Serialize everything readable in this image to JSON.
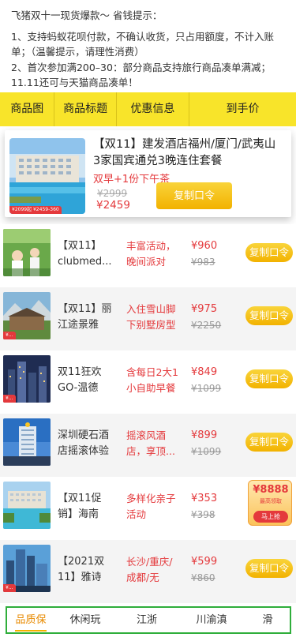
{
  "notice": {
    "title": "飞猪双十一现货爆款～ 省钱提示：",
    "line1": "1、支持蚂蚁花呗付款，不确认收货，只占用额度，不计入账单；（温馨提示，请理性消费）",
    "line2": "2、首次参加满200–30：部分商品支持旅行商品凑单满减；11.11还可与天猫商品凑单！"
  },
  "columns": {
    "image": "商品图",
    "title": "商品标题",
    "promo": "优惠信息",
    "price": "到手价"
  },
  "featured": {
    "title": "【双11】建发酒店福州/厦门/武夷山3家国宾通兑3晚连住套餐",
    "subtitle": "双早+1份下午茶",
    "original_price": "¥2999",
    "price": "¥2459",
    "button": "复制口令",
    "thumb_tag": "¥2099起 ¥2459-360"
  },
  "items": [
    {
      "name": "【双11】clubmed...",
      "promo": "丰富活动，晚间派对",
      "price": "¥960",
      "original": "¥983",
      "button": "复制口令"
    },
    {
      "name": "【双11】丽江途景雅阁...",
      "promo": "入住雪山脚下别墅房型",
      "price": "¥975",
      "original": "¥2250",
      "button": "复制口令"
    },
    {
      "name": "双11狂欢GO-温德姆...",
      "promo": "含每日2大1小自助早餐",
      "price": "¥849",
      "original": "¥1099",
      "button": "复制口令"
    },
    {
      "name": "深圳硬石酒店摇滚体验1...",
      "promo": "摇滚风酒店，享顶...",
      "price": "¥899",
      "original": "¥1099",
      "button": "复制口令"
    },
    {
      "name": "【双11促销】海南海...",
      "promo": "多样化亲子活动",
      "price": "¥353",
      "original": "¥398",
      "button": ""
    },
    {
      "name": "【2021双11】雅诗阁...",
      "promo": "长沙/重庆/成都/无锡/...",
      "price": "¥599",
      "original": "¥860",
      "button": "复制口令"
    }
  ],
  "promo_badge": {
    "amount": "¥8888",
    "subtitle": "最高领取",
    "cta": "马上抢"
  },
  "tabs": [
    "品质保",
    "休闲玩",
    "江浙",
    "川渝滇",
    "滑"
  ],
  "colors": {
    "yellow_header": "#f8e42a",
    "accent_red": "#e4393c",
    "button_yellow": "#f2b200",
    "tab_border_green": "#2fae3b"
  }
}
